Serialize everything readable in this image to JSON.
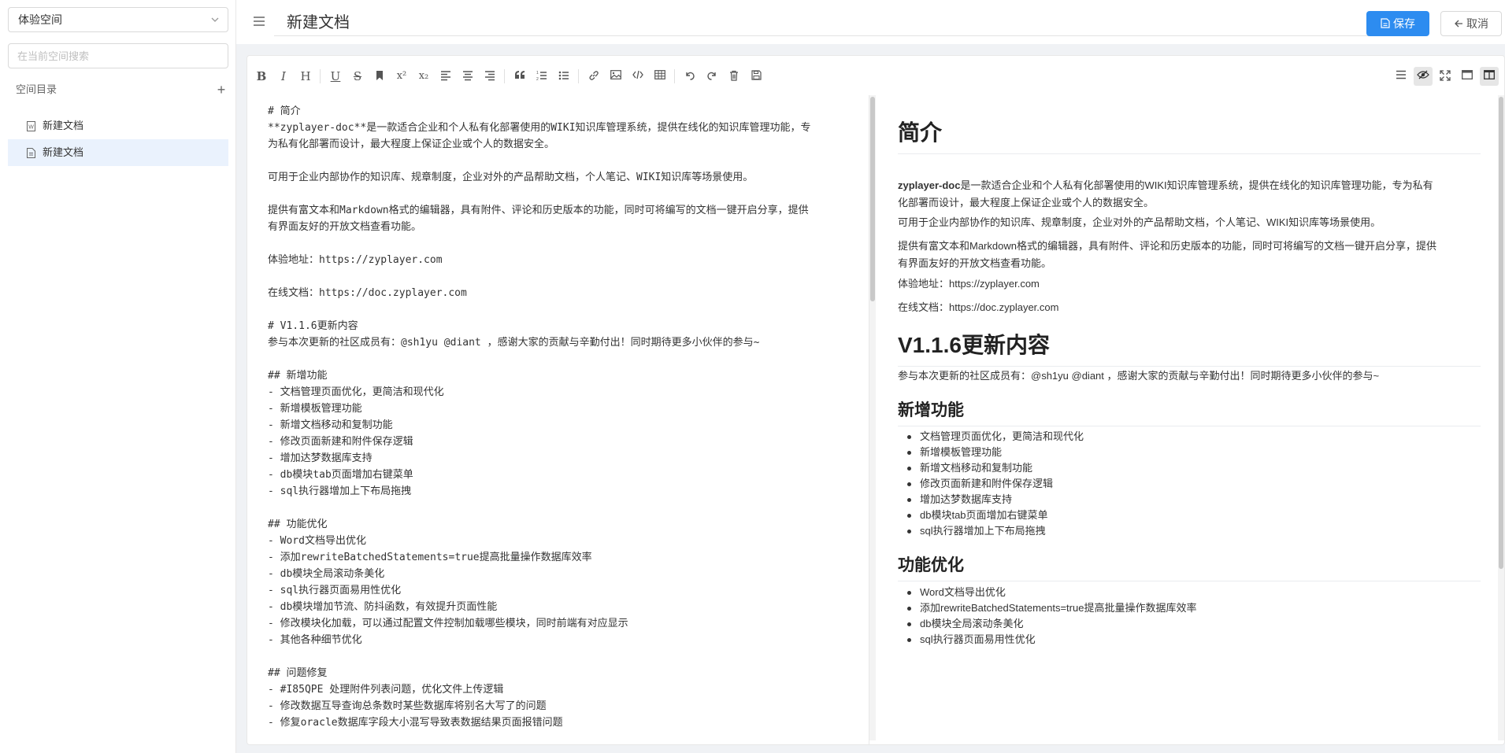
{
  "sidebar": {
    "space_select": "体验空间",
    "search_placeholder": "在当前空间搜索",
    "dir_title": "空间目录",
    "add_symbol": "+",
    "items": [
      {
        "label": "新建文档",
        "icon": "word-doc-icon"
      },
      {
        "label": "新建文档",
        "icon": "markdown-doc-icon"
      }
    ]
  },
  "header": {
    "title": "新建文档",
    "save_label": "保存",
    "cancel_label": "取消",
    "accent_color": "#2d8cf0"
  },
  "toolbar": {
    "bold": "B",
    "italic": "I",
    "heading": "H",
    "underline": "U",
    "strike": "S",
    "sup": "x²",
    "sub": "x₂"
  },
  "source_lines": [
    "# 简介",
    "**zyplayer-doc**是一款适合企业和个人私有化部署使用的WIKI知识库管理系统，提供在线化的知识库管理功能，专",
    "为私有化部署而设计，最大程度上保证企业或个人的数据安全。",
    "",
    "可用于企业内部协作的知识库、规章制度，企业对外的产品帮助文档，个人笔记、WIKI知识库等场景使用。",
    "",
    "提供有富文本和Markdown格式的编辑器，具有附件、评论和历史版本的功能，同时可将编写的文档一键开启分享，提供",
    "有界面友好的开放文档查看功能。",
    "",
    "体验地址：https://zyplayer.com",
    "",
    "在线文档：https://doc.zyplayer.com",
    "",
    "# V1.1.6更新内容",
    "参与本次更新的社区成员有：@sh1yu @diant ，感谢大家的贡献与辛勤付出！同时期待更多小伙伴的参与~",
    "",
    "## 新增功能",
    "- 文档管理页面优化，更简洁和现代化",
    "- 新增模板管理功能",
    "- 新增文档移动和复制功能",
    "- 修改页面新建和附件保存逻辑",
    "- 增加达梦数据库支持",
    "- db模块tab页面增加右键菜单",
    "- sql执行器增加上下布局拖拽",
    "",
    "## 功能优化",
    "- Word文档导出优化",
    "- 添加rewriteBatchedStatements=true提高批量操作数据库效率",
    "- db模块全局滚动条美化",
    "- sql执行器页面易用性优化",
    "- db模块增加节流、防抖函数，有效提升页面性能",
    "- 修改模块化加载，可以通过配置文件控制加载哪些模块，同时前端有对应显示",
    "- 其他各种细节优化",
    "",
    "## 问题修复",
    "- #I85QPE 处理附件列表问题，优化文件上传逻辑",
    "- 修改数据互导查询总条数时某些数据库将别名大写了的问题",
    "- 修复oracle数据库字段大小混写导致表数据结果页面报错问题"
  ],
  "preview": {
    "h1_intro": "简介",
    "intro_bold": "zyplayer-doc",
    "intro_rest_1": "是一款适合企业和个人私有化部署使用的WIKI知识库管理系统，提供在线化的知识库管理功能，专为私有",
    "intro_rest_2": "化部署而设计，最大程度上保证企业或个人的数据安全。",
    "p2": "可用于企业内部协作的知识库、规章制度，企业对外的产品帮助文档，个人笔记、WIKI知识库等场景使用。",
    "p3_1": "提供有富文本和Markdown格式的编辑器，具有附件、评论和历史版本的功能，同时可将编写的文档一键开启分享，提供",
    "p3_2": "有界面友好的开放文档查看功能。",
    "p4": "体验地址：https://zyplayer.com",
    "p5": "在线文档：https://doc.zyplayer.com",
    "h1_update": "V1.1.6更新内容",
    "p6": "参与本次更新的社区成员有：@sh1yu @diant ，感谢大家的贡献与辛勤付出！同时期待更多小伙伴的参与~",
    "h2_new": "新增功能",
    "new_items": [
      "文档管理页面优化，更简洁和现代化",
      "新增模板管理功能",
      "新增文档移动和复制功能",
      "修改页面新建和附件保存逻辑",
      "增加达梦数据库支持",
      "db模块tab页面增加右键菜单",
      "sql执行器增加上下布局拖拽"
    ],
    "h2_opt": "功能优化",
    "opt_items": [
      "Word文档导出优化",
      "添加rewriteBatchedStatements=true提高批量操作数据库效率",
      "db模块全局滚动条美化",
      "sql执行器页面易用性优化"
    ]
  }
}
